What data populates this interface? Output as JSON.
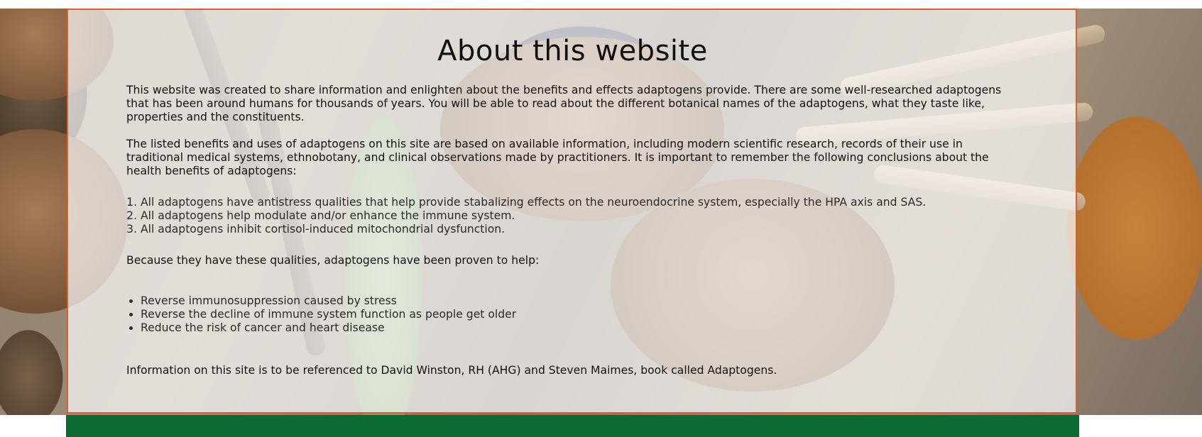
{
  "page": {
    "title": "About this website",
    "paragraphs": {
      "intro": "This website was created to share information and enlighten about the benefits and effects adaptogens provide. There are some well-researched adaptogens that has been around humans for thousands of years. You will be able to read about the different botanical names of the adaptogens, what they taste like, properties and the constituents.",
      "sources": "The listed benefits and uses of adaptogens on this site are based on available information, including modern scientific research, records of their use in traditional medical systems, ethnobotany, and clinical observations made by practitioners. It is important to remember the following conclusions about the health benefits of adaptogens:",
      "because": "Because they have these qualities, adaptogens have been proven to help:",
      "reference": "Information on this site is to be referenced to David Winston, RH (AHG) and Steven Maimes, book called Adaptogens."
    },
    "conclusions": [
      "All adaptogens have antistress qualities that help provide stabalizing effects on the neuroendocrine system, especially the HPA axis and SAS.",
      "All adaptogens help modulate and/or enhance the immune system.",
      "All adaptogens inhibit cortisol-induced mitochondrial dysfunction."
    ],
    "benefits": [
      "Reverse immunosuppression caused by stress",
      "Reverse the decline of immune system function as people get older",
      "Reduce the risk of cancer and heart disease"
    ]
  },
  "colors": {
    "card_border": "#d9602a",
    "footer_bar": "#0c6b32",
    "text": "#111111"
  }
}
